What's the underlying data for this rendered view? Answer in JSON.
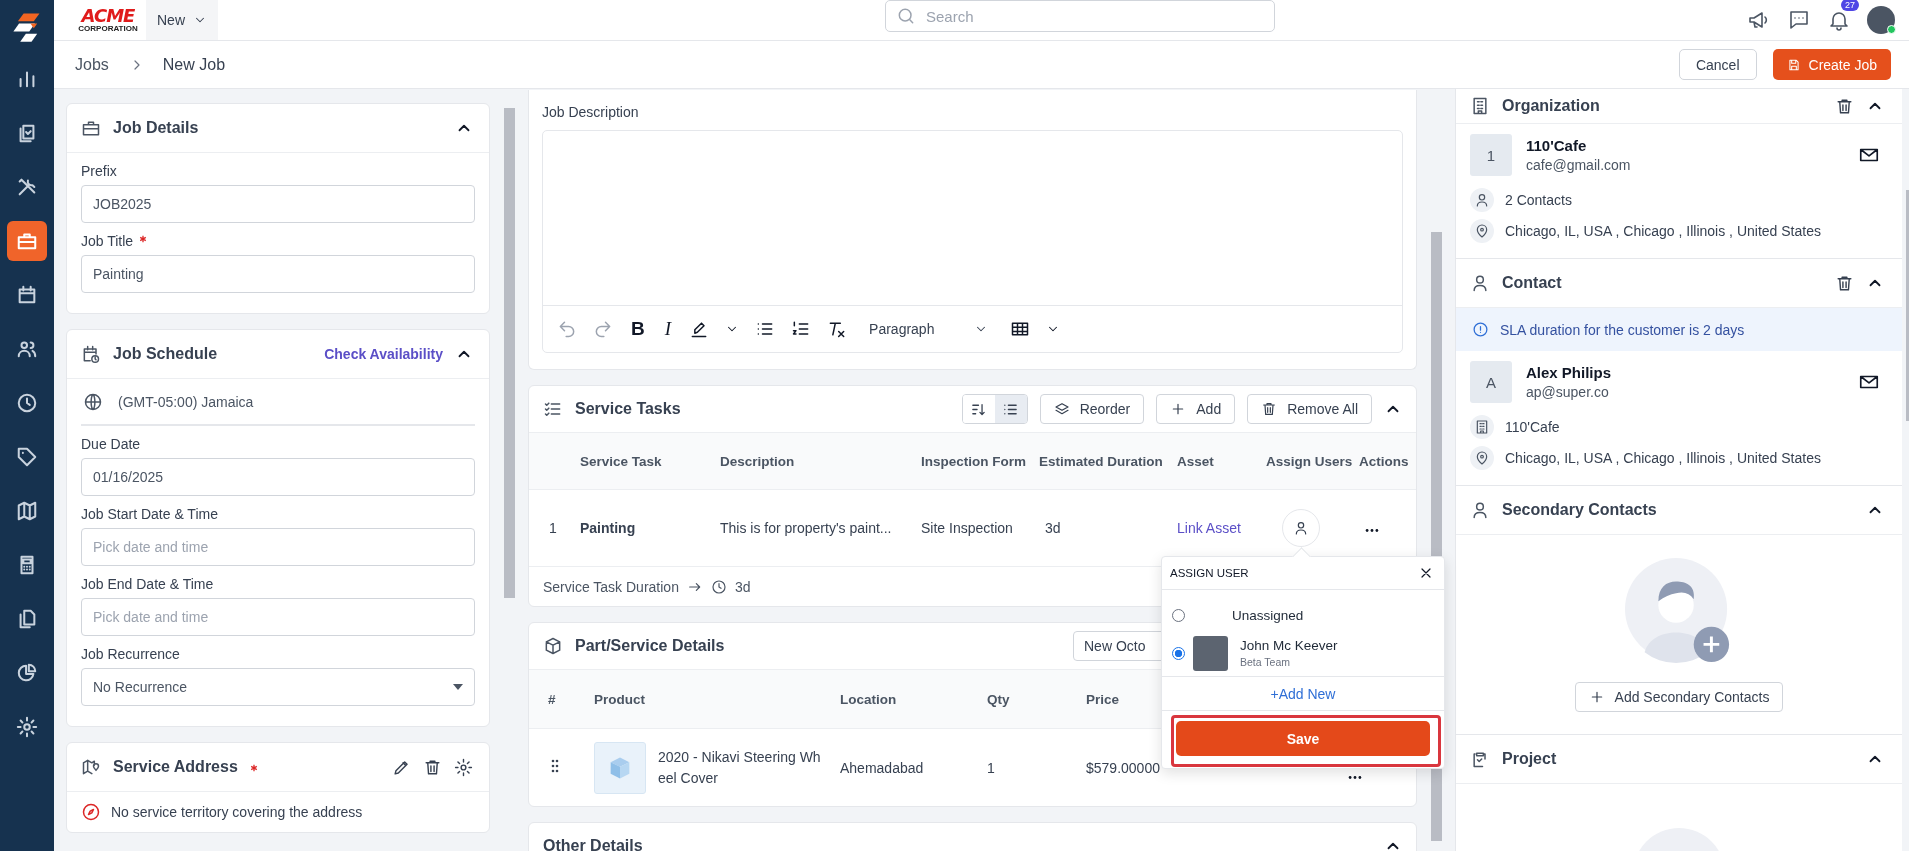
{
  "nav": {
    "items": [
      {
        "kind": "chart",
        "selected": false
      },
      {
        "kind": "clipboard",
        "selected": false
      },
      {
        "kind": "tools",
        "selected": false
      },
      {
        "kind": "briefcase",
        "selected": true
      },
      {
        "kind": "calendar",
        "selected": false
      },
      {
        "kind": "users",
        "selected": false
      },
      {
        "kind": "clock",
        "selected": false
      },
      {
        "kind": "tag",
        "selected": false
      },
      {
        "kind": "map",
        "selected": false
      },
      {
        "kind": "calculator",
        "selected": false
      },
      {
        "kind": "documents",
        "selected": false
      },
      {
        "kind": "pie",
        "selected": false
      },
      {
        "kind": "gear",
        "selected": false
      }
    ]
  },
  "topbar": {
    "logo": {
      "name": "ACME",
      "subtitle": "CORPORATION"
    },
    "new_menu": "New",
    "search": {
      "placeholder": "Search"
    },
    "notification_count": "27",
    "user_online": true
  },
  "breadcrumb": [
    "Jobs",
    "New Job"
  ],
  "page_actions": {
    "cancel": "Cancel",
    "create": "Create Job"
  },
  "job_details": {
    "title": "Job Details",
    "expanded": true,
    "fields": [
      {
        "label": "Prefix",
        "required": false,
        "value": "JOB2025"
      },
      {
        "label": "Job Title",
        "required": true,
        "value": "Painting"
      }
    ]
  },
  "job_schedule": {
    "title": "Job Schedule",
    "link": "Check Availability",
    "expanded": true,
    "timezone": "(GMT-05:00) Jamaica",
    "fields": [
      {
        "kind": "input",
        "label": "Due Date",
        "value": "01/16/2025"
      },
      {
        "kind": "input",
        "label": "Job Start Date & Time",
        "placeholder": "Pick date and time"
      },
      {
        "kind": "input",
        "label": "Job End Date & Time",
        "placeholder": "Pick date and time"
      },
      {
        "kind": "select",
        "label": "Job Recurrence",
        "value": "No Recurrence"
      }
    ]
  },
  "service_address": {
    "title": "Service Address",
    "required": true,
    "notice": "No service territory covering the address"
  },
  "job_description": {
    "label": "Job Description",
    "format_buttons": [
      "B",
      "I"
    ],
    "block_style": "Paragraph"
  },
  "service_tasks": {
    "title": "Service Tasks",
    "expanded": true,
    "views": [
      {
        "kind": "sort",
        "selected": false
      },
      {
        "kind": "list",
        "selected": true
      }
    ],
    "buttons": [
      {
        "kind": "reorder",
        "label": "Reorder"
      },
      {
        "kind": "add",
        "label": "Add"
      },
      {
        "kind": "remove",
        "label": "Remove All"
      }
    ],
    "columns": [
      "Service Task",
      "Description",
      "Inspection Form",
      "Estimated Duration",
      "Asset",
      "Assign Users",
      "Actions"
    ],
    "rows": [
      {
        "index": "1",
        "task": "Painting",
        "description": "This is for property's paint...",
        "inspection_form": "Site Inspection",
        "duration": "3d",
        "asset_link": "Link Asset"
      }
    ],
    "footer": {
      "label": "Service Task Duration",
      "value": "3d"
    }
  },
  "parts": {
    "title": "Part/Service Details",
    "select": "New Octo",
    "columns": [
      "#",
      "Product",
      "Location",
      "Qty",
      "Price"
    ],
    "rows": [
      {
        "product": "2020 - Nikavi Steering Wheel Cover",
        "location": "Ahemadabad",
        "qty": "1",
        "price": "$579.00000"
      }
    ]
  },
  "other_details": {
    "title": "Other Details",
    "expanded": true
  },
  "assign_popup": {
    "title": "ASSIGN USER",
    "options": [
      {
        "name": "Unassigned",
        "selected": false
      },
      {
        "name": "John Mc Keever",
        "team": "Beta Team",
        "selected": true
      }
    ],
    "add_new": "+Add New",
    "save": "Save",
    "save_highlighted": true
  },
  "organization": {
    "title": "Organization",
    "expanded": true,
    "initial": "1",
    "name": "110'Cafe",
    "email": "cafe@gmail.com",
    "contacts": "2 Contacts",
    "address": "Chicago, IL, USA , Chicago , Illinois , United States"
  },
  "contact": {
    "title": "Contact",
    "expanded": true,
    "sla": "SLA duration for the customer is 2 days",
    "initial": "A",
    "name": "Alex Philips",
    "email": "ap@super.co",
    "organization": "110'Cafe",
    "address": "Chicago, IL, USA , Chicago , Illinois , United States"
  },
  "secondary_contacts": {
    "title": "Secondary Contacts",
    "expanded": true,
    "button": "Add Secondary Contacts"
  },
  "project": {
    "title": "Project",
    "expanded": true
  }
}
